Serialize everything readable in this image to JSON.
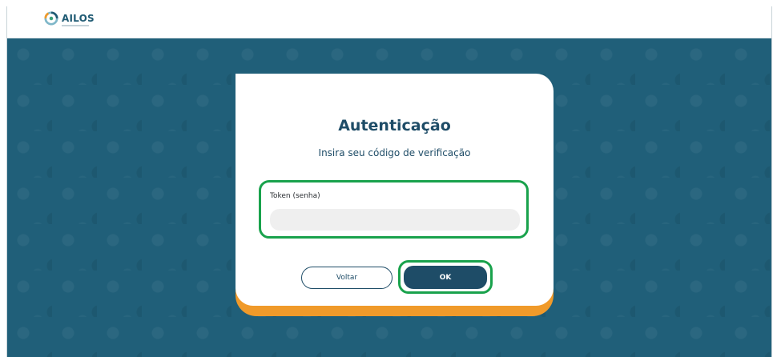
{
  "header": {
    "logo_text": "AILOS"
  },
  "dialog": {
    "title": "Autenticação",
    "subtitle": "Insira seu código de verificação",
    "token": {
      "label": "Token (senha)",
      "value": "",
      "placeholder": ""
    },
    "buttons": {
      "back_label": "Voltar",
      "ok_label": "OK"
    }
  },
  "colors": {
    "primary": "#1e4c67",
    "background": "#205f79",
    "accent": "#f09a2a",
    "highlight": "#19a24c"
  }
}
